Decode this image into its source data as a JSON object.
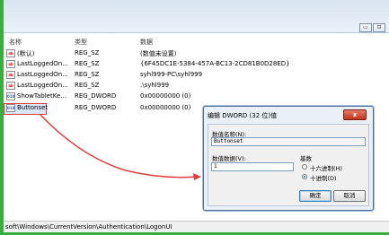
{
  "colors": {
    "frame": "#36b03a",
    "highlight": "#e23b3b",
    "selection": "#d9e6ff"
  },
  "window": {
    "min_glyph": "▭",
    "max_glyph": "⊡"
  },
  "headers": {
    "name": "名称",
    "type": "类型",
    "data": "数据"
  },
  "rows": [
    {
      "icon": "string-value-icon",
      "glyph": "ab",
      "name": "(默认)",
      "type": "REG_SZ",
      "data": "(数值未设置)"
    },
    {
      "icon": "string-value-icon",
      "glyph": "ab",
      "name": "LastLoggedOn...",
      "type": "REG_SZ",
      "data": "{6F45DC1E-5384-457A-BC13-2CD81B0D28ED}"
    },
    {
      "icon": "string-value-icon",
      "glyph": "ab",
      "name": "LastLoggedOn...",
      "type": "REG_SZ",
      "data": "syhl999-PC\\syhl999"
    },
    {
      "icon": "string-value-icon",
      "glyph": "ab",
      "name": "LastLoggedOn...",
      "type": "REG_SZ",
      "data": ".\\syhl999"
    },
    {
      "icon": "binary-value-icon",
      "glyph": "010",
      "name": "ShowTabletKe...",
      "type": "REG_DWORD",
      "data": "0x00000000 (0)"
    },
    {
      "icon": "binary-value-icon",
      "glyph": "010",
      "name": "Buttonset",
      "type": "REG_DWORD",
      "data": "0x00000000 (0)"
    }
  ],
  "status_path": "soft\\Windows\\CurrentVersion\\Authentication\\LogonUI",
  "dialog": {
    "title": "编辑 DWORD (32 位)值",
    "close_glyph": "x",
    "name_label": "数值名称(N):",
    "name_value": "Buttonset",
    "data_label": "数值数据(V):",
    "data_value": "1",
    "base_label": "基数",
    "hex_label": "十六进制(H)",
    "dec_label": "十进制(D)",
    "selected_base": "十进制(D)",
    "ok_label": "确定",
    "cancel_label": "取消"
  }
}
